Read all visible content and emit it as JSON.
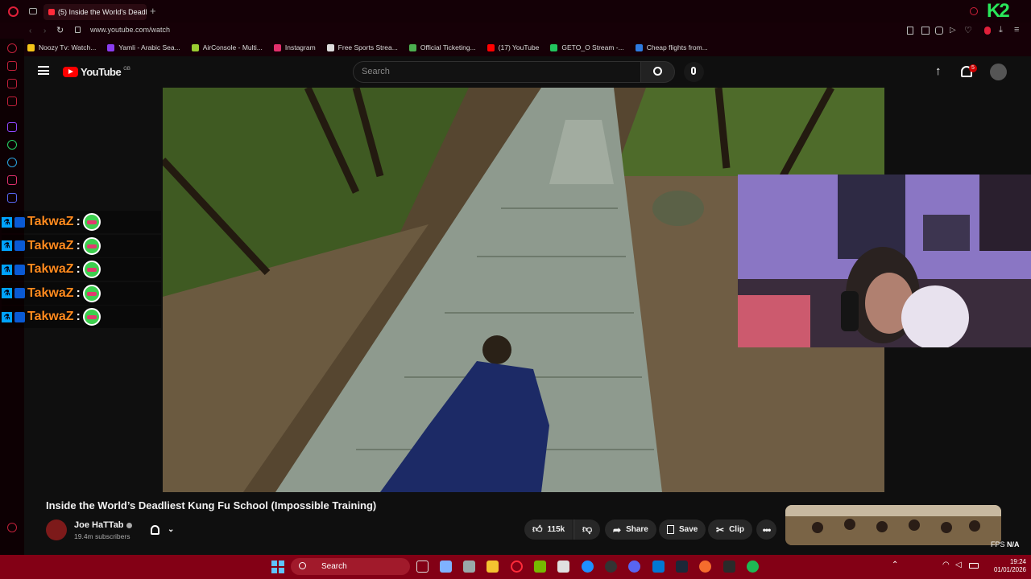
{
  "browser": {
    "tab_title": "(5) Inside the World's Deadl",
    "url": "www.youtube.com/watch",
    "bookmarks": [
      {
        "label": "Noozy Tv: Watch...",
        "color": "#f5c518"
      },
      {
        "label": "Yamli - Arabic Sea...",
        "color": "#8a3df0"
      },
      {
        "label": "AirConsole - Multi...",
        "color": "#9acd32"
      },
      {
        "label": "Instagram",
        "color": "#e1306c"
      },
      {
        "label": "Free Sports Strea...",
        "color": "#dddddd"
      },
      {
        "label": "Official Ticketing...",
        "color": "#4caf50"
      },
      {
        "label": "(17) YouTube",
        "color": "#ff0000"
      },
      {
        "label": "GETO_O Stream -...",
        "color": "#22c55e"
      },
      {
        "label": "Cheap flights from...",
        "color": "#2d7be0"
      }
    ]
  },
  "youtube": {
    "logo_text": "YouTube",
    "region": "GB",
    "search_placeholder": "Search",
    "notifications_count": "5"
  },
  "chat": {
    "messages": [
      {
        "user": "TakwaZ",
        "sep": ":"
      },
      {
        "user": "TakwaZ",
        "sep": ":"
      },
      {
        "user": "TakwaZ",
        "sep": ":"
      },
      {
        "user": "TakwaZ",
        "sep": ":"
      },
      {
        "user": "TakwaZ",
        "sep": ":"
      }
    ]
  },
  "video": {
    "title": "Inside the World’s Deadliest Kung Fu School (Impossible Training)",
    "channel": "Joe HaTTab",
    "subscribers": "19.4m subscribers",
    "likes": "115k",
    "share_label": "Share",
    "save_label": "Save",
    "clip_label": "Clip"
  },
  "overlay": {
    "logo": "K2",
    "fps_label": "FPS",
    "fps_value": "N/A"
  },
  "taskbar": {
    "search_label": "Search",
    "time": "19:24",
    "date": "01/01/2026"
  }
}
